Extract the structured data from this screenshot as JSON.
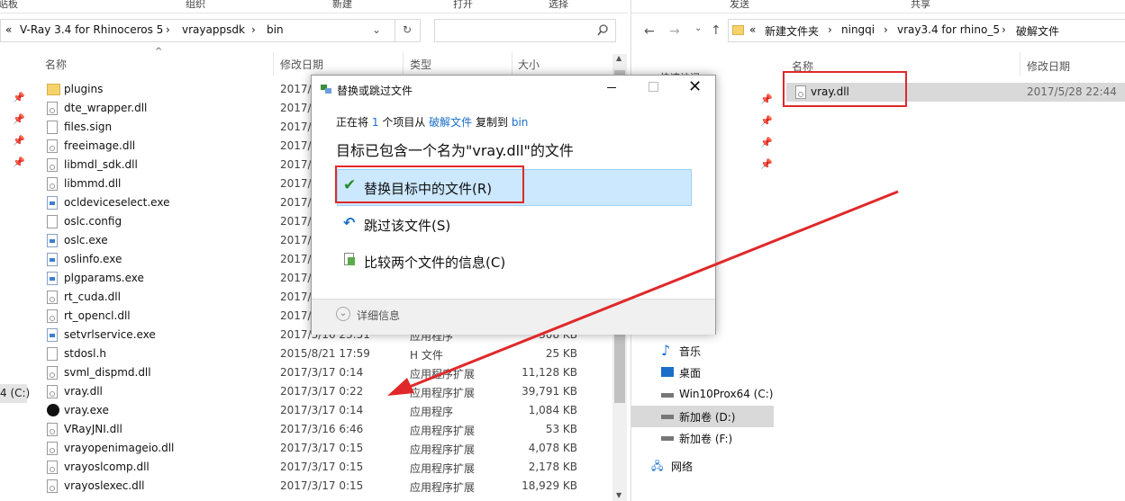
{
  "left_window": {
    "ribbon": [
      "贴板",
      "组织",
      "新建",
      "打开",
      "选择"
    ],
    "breadcrumb": [
      "V-Ray 3.4 for Rhinoceros 5",
      "vrayappsdk",
      "bin"
    ],
    "columns": {
      "name": "名称",
      "date": "修改日期",
      "type": "类型",
      "size": "大小"
    },
    "drive_label": "4 (C:)",
    "files": [
      {
        "name": "plugins",
        "date": "2017/",
        "type": "",
        "size": "",
        "icon": "folder"
      },
      {
        "name": "dte_wrapper.dll",
        "date": "2017/",
        "type": "",
        "size": "",
        "icon": "dll"
      },
      {
        "name": "files.sign",
        "date": "2017/",
        "type": "",
        "size": "",
        "icon": "file"
      },
      {
        "name": "freeimage.dll",
        "date": "2017/",
        "type": "",
        "size": "",
        "icon": "dll"
      },
      {
        "name": "libmdl_sdk.dll",
        "date": "2017/",
        "type": "",
        "size": "",
        "icon": "dll"
      },
      {
        "name": "libmmd.dll",
        "date": "2017/",
        "type": "",
        "size": "",
        "icon": "dll"
      },
      {
        "name": "ocldeviceselect.exe",
        "date": "2017/",
        "type": "",
        "size": "",
        "icon": "exe"
      },
      {
        "name": "oslc.config",
        "date": "2017/",
        "type": "",
        "size": "",
        "icon": "file"
      },
      {
        "name": "oslc.exe",
        "date": "2017/",
        "type": "",
        "size": "",
        "icon": "exe"
      },
      {
        "name": "oslinfo.exe",
        "date": "2017/",
        "type": "",
        "size": "",
        "icon": "exe"
      },
      {
        "name": "plgparams.exe",
        "date": "2017/",
        "type": "",
        "size": "",
        "icon": "exe"
      },
      {
        "name": "rt_cuda.dll",
        "date": "2017/",
        "type": "",
        "size": "",
        "icon": "dll"
      },
      {
        "name": "rt_opencl.dll",
        "date": "2017/",
        "type": "",
        "size": "",
        "icon": "dll"
      },
      {
        "name": "setvrlservice.exe",
        "date": "2017/3/16 23:51",
        "type": "应用程序",
        "size": "308 KB",
        "icon": "exe"
      },
      {
        "name": "stdosl.h",
        "date": "2015/8/21 17:59",
        "type": "H 文件",
        "size": "25 KB",
        "icon": "file"
      },
      {
        "name": "svml_dispmd.dll",
        "date": "2017/3/17 0:14",
        "type": "应用程序扩展",
        "size": "11,128 KB",
        "icon": "dll"
      },
      {
        "name": "vray.dll",
        "date": "2017/3/17 0:22",
        "type": "应用程序扩展",
        "size": "39,791 KB",
        "icon": "dll"
      },
      {
        "name": "vray.exe",
        "date": "2017/3/17 0:14",
        "type": "应用程序",
        "size": "1,084 KB",
        "icon": "vray"
      },
      {
        "name": "VRayJNI.dll",
        "date": "2017/3/16 6:46",
        "type": "应用程序扩展",
        "size": "53 KB",
        "icon": "dll"
      },
      {
        "name": "vrayopenimageio.dll",
        "date": "2017/3/17 0:15",
        "type": "应用程序扩展",
        "size": "4,078 KB",
        "icon": "dll"
      },
      {
        "name": "vrayoslcomp.dll",
        "date": "2017/3/17 0:15",
        "type": "应用程序扩展",
        "size": "2,178 KB",
        "icon": "dll"
      },
      {
        "name": "vrayoslexec.dll",
        "date": "2017/3/17 0:15",
        "type": "应用程序扩展",
        "size": "18,929 KB",
        "icon": "dll"
      }
    ]
  },
  "right_window": {
    "ribbon": [
      "发送",
      "共享"
    ],
    "breadcrumb": [
      "新建文件夹",
      "ningqi",
      "vray3.4 for rhino_5",
      "破解文件"
    ],
    "columns": {
      "name": "名称",
      "date": "修改日期"
    },
    "file": {
      "name": "vray.dll",
      "date": "2017/5/28 22:44"
    },
    "nav": [
      {
        "label": "音乐",
        "icon": "music"
      },
      {
        "label": "桌面",
        "icon": "desktop"
      },
      {
        "label": "Win10Prox64 (C:)",
        "icon": "windows-drive"
      },
      {
        "label": "新加卷 (D:)",
        "icon": "drive",
        "selected": true
      },
      {
        "label": "新加卷 (F:)",
        "icon": "drive"
      },
      {
        "label": "网络",
        "icon": "network"
      }
    ]
  },
  "dialog": {
    "title": "替换或跳过文件",
    "status": {
      "prefix": "正在将",
      "count": "1",
      "middle": "个项目从",
      "source": "破解文件",
      "copy_to": "复制到",
      "dest": "bin"
    },
    "headline": "目标已包含一个名为\"vray.dll\"的文件",
    "options": [
      {
        "label": "替换目标中的文件(R)",
        "icon": "check-icon"
      },
      {
        "label": "跳过该文件(S)",
        "icon": "skip-icon"
      },
      {
        "label": "比较两个文件的信息(C)",
        "icon": "compare-icon"
      }
    ],
    "details": "详细信息"
  },
  "colors": {
    "accent_blue": "#1a6fc8",
    "highlight": "#cce8ff",
    "annotation_red": "#e0282a"
  }
}
